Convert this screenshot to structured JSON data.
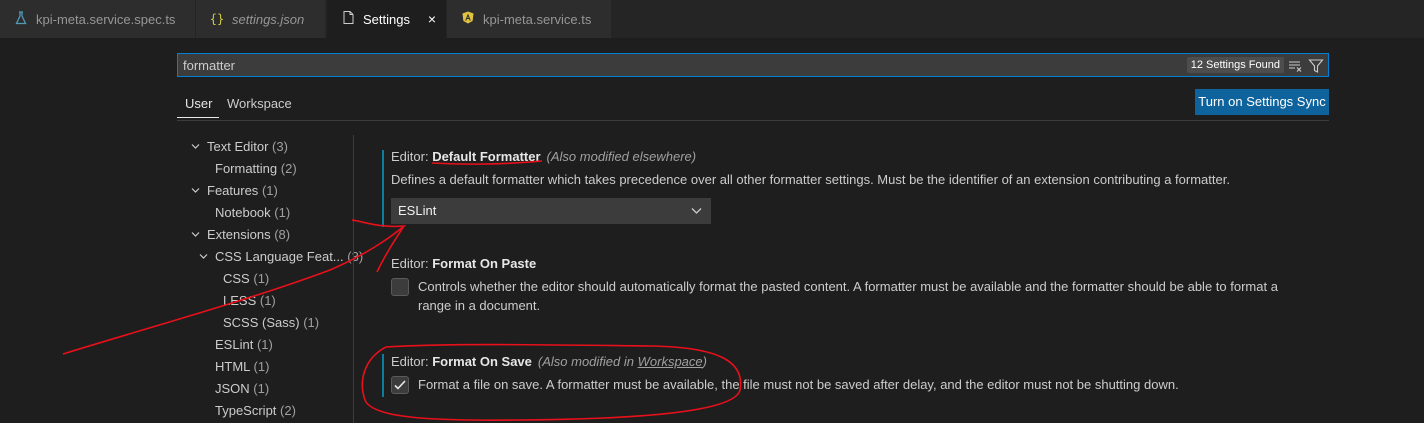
{
  "tabs": [
    {
      "label": "kpi-meta.service.spec.ts",
      "icon": "flask-icon"
    },
    {
      "label": "settings.json",
      "icon": "braces-icon"
    },
    {
      "label": "Settings",
      "icon": "file-icon",
      "close": "×"
    },
    {
      "label": "kpi-meta.service.ts",
      "icon": "angular-icon"
    }
  ],
  "search": {
    "value": "formatter",
    "count": "12 Settings Found"
  },
  "scope": {
    "user": "User",
    "workspace": "Workspace",
    "sync_button": "Turn on Settings Sync"
  },
  "toc": [
    {
      "label": "Text Editor",
      "count": "(3)"
    },
    {
      "label": "Formatting",
      "count": "(2)"
    },
    {
      "label": "Features",
      "count": "(1)"
    },
    {
      "label": "Notebook",
      "count": "(1)"
    },
    {
      "label": "Extensions",
      "count": "(8)"
    },
    {
      "label": "CSS Language Feat...",
      "count": "(3)"
    },
    {
      "label": "CSS",
      "count": "(1)"
    },
    {
      "label": "LESS",
      "count": "(1)"
    },
    {
      "label": "SCSS (Sass)",
      "count": "(1)"
    },
    {
      "label": "ESLint",
      "count": "(1)"
    },
    {
      "label": "HTML",
      "count": "(1)"
    },
    {
      "label": "JSON",
      "count": "(1)"
    },
    {
      "label": "TypeScript",
      "count": "(2)"
    }
  ],
  "settings": {
    "default_formatter": {
      "category": "Editor: ",
      "name": "Default Formatter",
      "note": "(Also modified elsewhere)",
      "description": "Defines a default formatter which takes precedence over all other formatter settings. Must be the identifier of an extension contributing a formatter.",
      "value": "ESLint"
    },
    "format_on_paste": {
      "category": "Editor: ",
      "name": "Format On Paste",
      "description_line1": "Controls whether the editor should automatically format the pasted content. A formatter must be available and the formatter should be able to format a",
      "description_line2": "range in a document.",
      "checked": false
    },
    "format_on_save": {
      "category": "Editor: ",
      "name": "Format On Save",
      "note_prefix": "(Also modified in ",
      "note_link": "Workspace",
      "note_suffix": ")",
      "description": "Format a file on save. A formatter must be available, the file must not be saved after delay, and the editor must not be shutting down.",
      "checked": true
    }
  },
  "colors": {
    "accent": "#007fd4",
    "button": "#0e639c",
    "modified_bar": "#0c7d9d",
    "annotation": "#e8101a"
  }
}
